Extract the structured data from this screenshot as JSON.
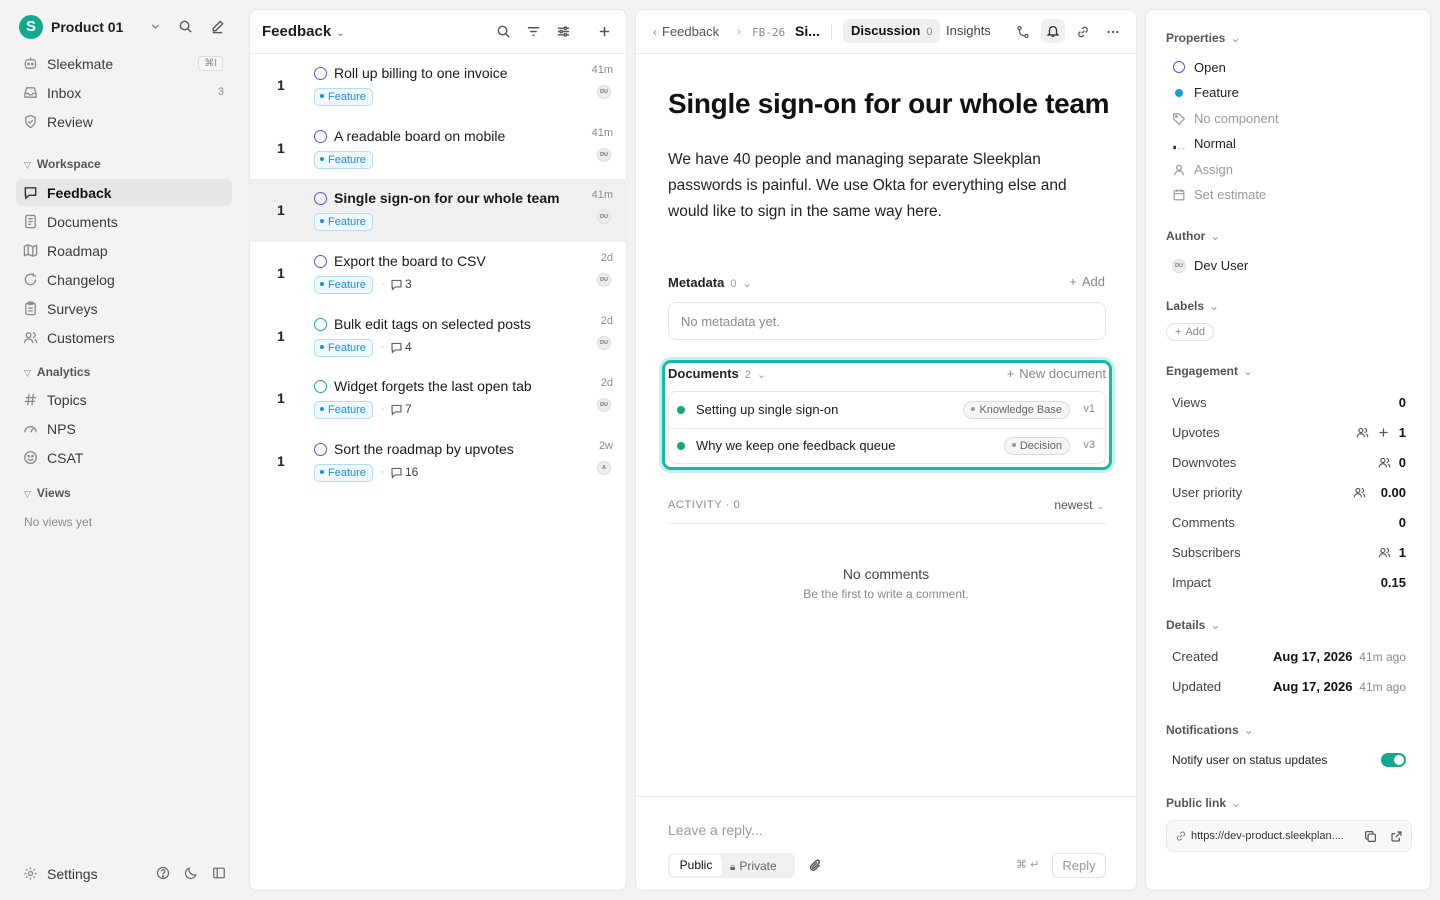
{
  "sidebar": {
    "workspace": "Product 01",
    "logo_letter": "S",
    "top": [
      {
        "label": "Sleekmate",
        "kbd": "⌘I"
      },
      {
        "label": "Inbox",
        "count": "3"
      },
      {
        "label": "Review"
      }
    ],
    "workspace_section": "Workspace",
    "workspace_items": [
      "Feedback",
      "Documents",
      "Roadmap",
      "Changelog",
      "Surveys",
      "Customers"
    ],
    "analytics_section": "Analytics",
    "analytics_items": [
      "Topics",
      "NPS",
      "CSAT"
    ],
    "views_section": "Views",
    "no_views": "No views yet",
    "settings": "Settings"
  },
  "list": {
    "title": "Feedback",
    "rows": [
      {
        "votes": "1",
        "title": "Roll up billing to one invoice",
        "tag": "Feature",
        "time": "41m",
        "avatar": "DU"
      },
      {
        "votes": "1",
        "title": "A readable board on mobile",
        "tag": "Feature",
        "time": "41m",
        "avatar": "DU"
      },
      {
        "votes": "1",
        "title": "Single sign-on for our whole team",
        "tag": "Feature",
        "time": "41m",
        "avatar": "DU"
      },
      {
        "votes": "1",
        "title": "Export the board to CSV",
        "tag": "Feature",
        "comments": "3",
        "time": "2d",
        "avatar": "DU"
      },
      {
        "votes": "1",
        "title": "Bulk edit tags on selected posts",
        "tag": "Feature",
        "comments": "4",
        "time": "2d",
        "avatar": "DU"
      },
      {
        "votes": "1",
        "title": "Widget forgets the last open tab",
        "tag": "Feature",
        "comments": "7",
        "time": "2d",
        "avatar": "DU"
      },
      {
        "votes": "1",
        "title": "Sort the roadmap by upvotes",
        "tag": "Feature",
        "comments": "16",
        "time": "2w",
        "avatar": "A"
      }
    ]
  },
  "detail": {
    "breadcrumb_parent": "Feedback",
    "id": "FB-26",
    "short_title": "Si...",
    "tabs": [
      {
        "label": "Discussion",
        "count": "0"
      },
      {
        "label": "Insights"
      }
    ],
    "title": "Single sign-on for our whole team",
    "description": "We have 40 people and managing separate Sleekplan passwords is painful. We use Okta for everything else and would like to sign in the same way here.",
    "metadata_label": "Metadata",
    "metadata_count": "0",
    "metadata_add": "Add",
    "metadata_empty": "No metadata yet.",
    "documents_label": "Documents",
    "documents_count": "2",
    "new_document": "New document",
    "documents": [
      {
        "title": "Setting up single sign-on",
        "chip": "Knowledge Base",
        "version": "v1"
      },
      {
        "title": "Why we keep one feedback queue",
        "chip": "Decision",
        "version": "v3"
      }
    ],
    "activity_label": "ACTIVITY · 0",
    "sort": "newest",
    "empty_title": "No comments",
    "empty_sub": "Be the first to write a comment.",
    "reply_placeholder": "Leave a reply...",
    "visibility": [
      "Public",
      "Private"
    ],
    "shortcut": "⌘ ↵",
    "reply_button": "Reply"
  },
  "props": {
    "properties_label": "Properties",
    "status": "Open",
    "type": "Feature",
    "component": "No component",
    "priority": "Normal",
    "assign": "Assign",
    "estimate": "Set estimate",
    "author_label": "Author",
    "author_avatar": "DU",
    "author": "Dev User",
    "labels_label": "Labels",
    "labels_add": "Add",
    "engagement_label": "Engagement",
    "engagement": [
      {
        "label": "Views",
        "value": "0"
      },
      {
        "label": "Upvotes",
        "value": "1"
      },
      {
        "label": "Downvotes",
        "value": "0"
      },
      {
        "label": "User priority",
        "value": "0.00"
      },
      {
        "label": "Comments",
        "value": "0"
      },
      {
        "label": "Subscribers",
        "value": "1"
      },
      {
        "label": "Impact",
        "value": "0.15"
      }
    ],
    "details_label": "Details",
    "created_label": "Created",
    "created_date": "Aug 17, 2026",
    "created_ago": "41m ago",
    "updated_label": "Updated",
    "updated_date": "Aug 17, 2026",
    "updated_ago": "41m ago",
    "notifications_label": "Notifications",
    "notify_label": "Notify user on status updates",
    "notify_on": true,
    "public_link_label": "Public link",
    "public_link": "https://dev-product.sleekplan...."
  },
  "colors": {
    "accent": "#14a88f",
    "feature": "#1f8fd0",
    "open": "#6b4bd6",
    "doc_highlight": "#1ab7a7"
  }
}
